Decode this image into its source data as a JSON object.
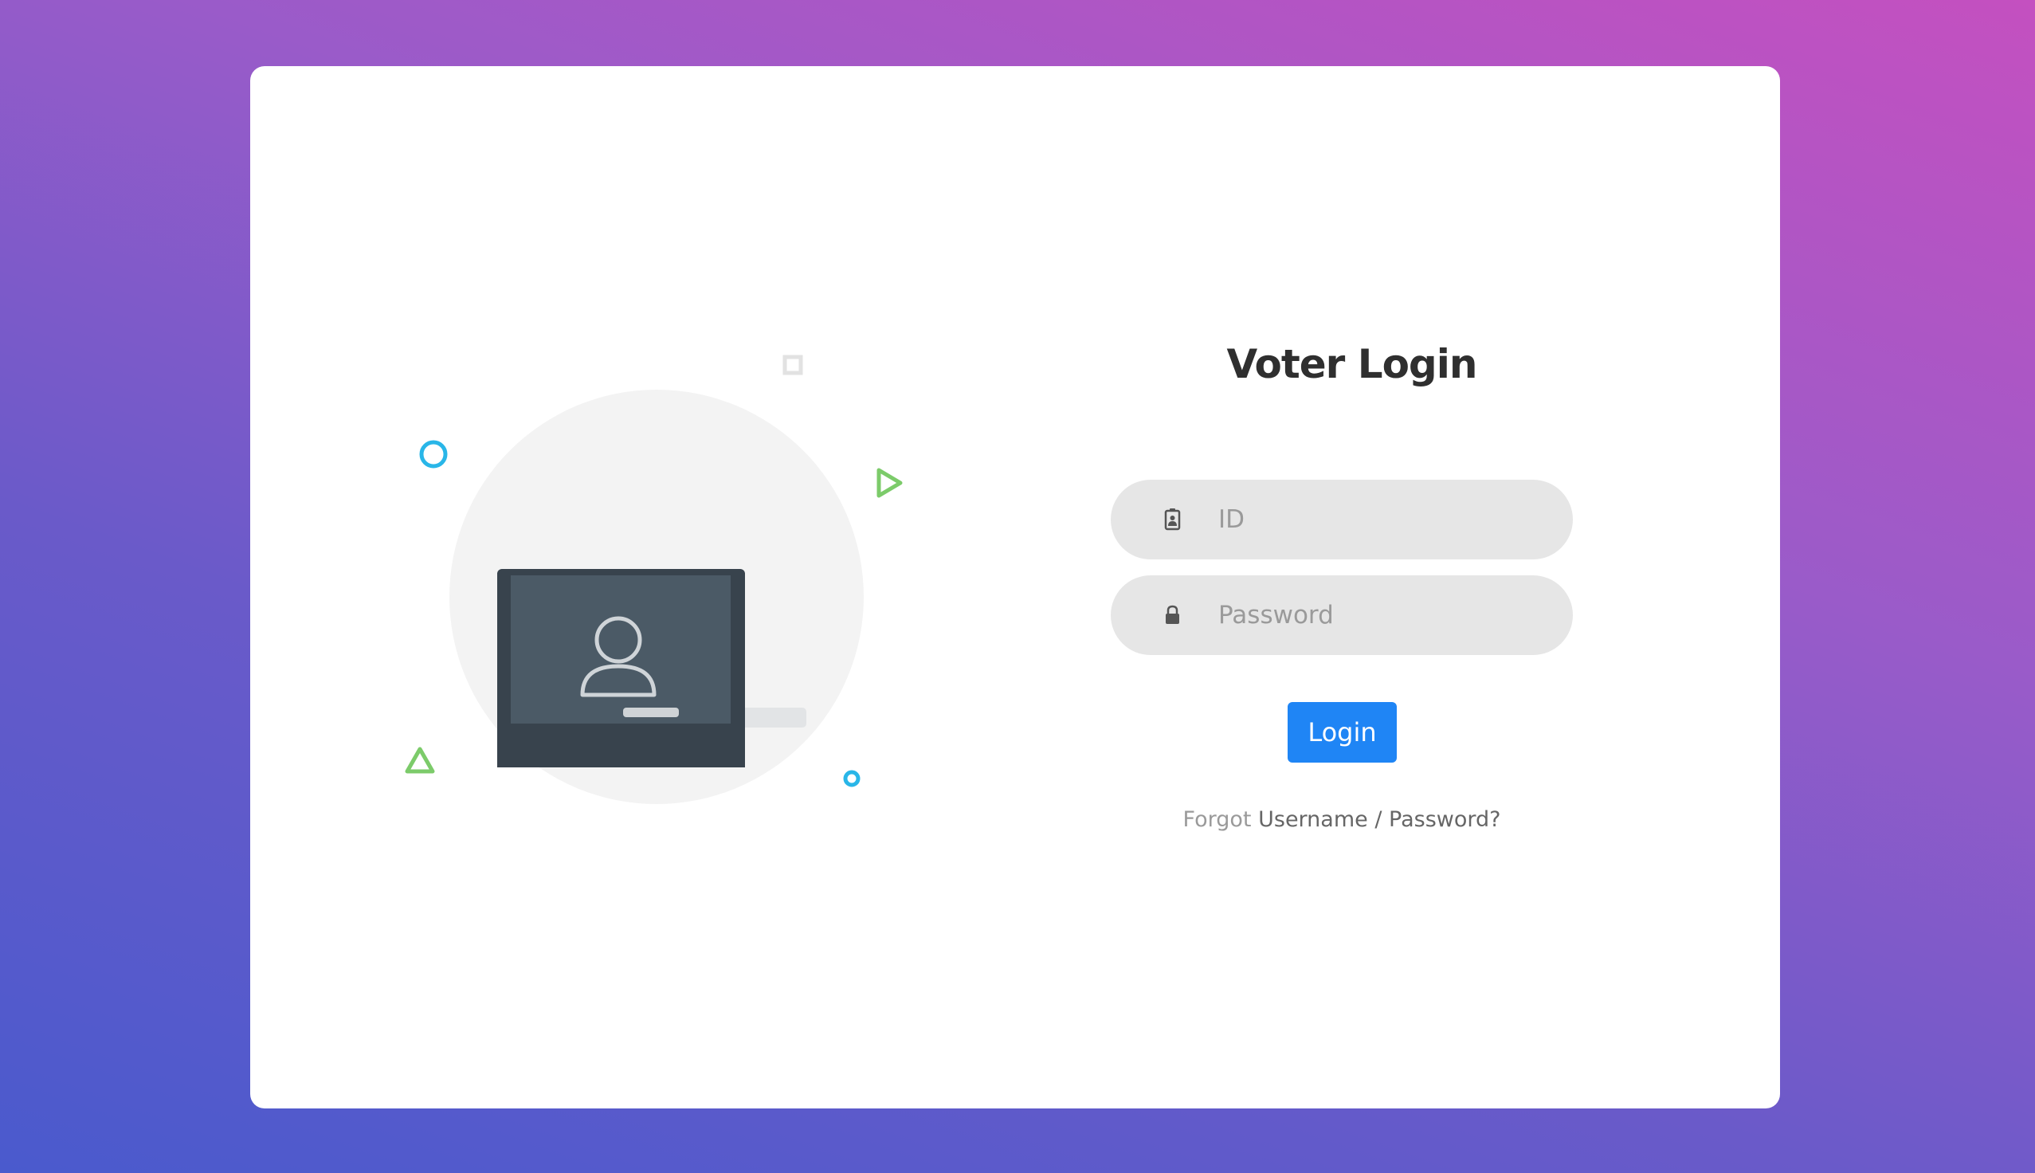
{
  "login": {
    "title": "Voter Login",
    "id_placeholder": "ID",
    "id_value": "",
    "password_placeholder": "Password",
    "password_value": "",
    "login_button": "Login",
    "forgot_prefix": "Forgot",
    "forgot_link": "Username / Password?"
  },
  "icons": {
    "id_field": "id-badge-icon",
    "password_field": "lock-icon",
    "illustration": "laptop-user-icon"
  },
  "colors": {
    "primary_button": "#1f85f5",
    "decor_blue": "#29b6e8",
    "decor_green": "#7ccb6a",
    "laptop_frame": "#38434d",
    "laptop_screen": "#4b5a66"
  }
}
